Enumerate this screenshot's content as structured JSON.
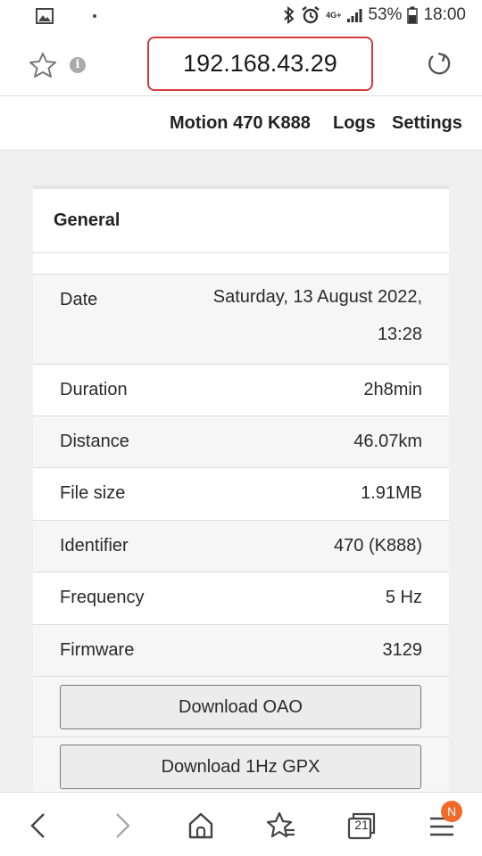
{
  "status_bar": {
    "network": "4G+",
    "battery": "53%",
    "time": "18:00"
  },
  "browser": {
    "url": "192.168.43.29",
    "tab_count": "21",
    "menu_badge": "N"
  },
  "nav": {
    "device": "Motion 470 K888",
    "logs": "Logs",
    "settings": "Settings"
  },
  "card": {
    "title": "General",
    "rows": [
      {
        "label": "Date",
        "value_line1": "Saturday, 13 August 2022,",
        "value_line2": "13:28"
      },
      {
        "label": "Duration",
        "value": "2h8min"
      },
      {
        "label": "Distance",
        "value": "46.07km"
      },
      {
        "label": "File size",
        "value": "1.91MB"
      },
      {
        "label": "Identifier",
        "value": "470 (K888)"
      },
      {
        "label": "Frequency",
        "value": "5 Hz"
      },
      {
        "label": "Firmware",
        "value": "3129"
      }
    ],
    "buttons": {
      "download_oao": "Download OAO",
      "download_gpx": "Download 1Hz GPX"
    }
  },
  "colors": {
    "url_border": "#d23b3b",
    "badge": "#f06a2a"
  }
}
